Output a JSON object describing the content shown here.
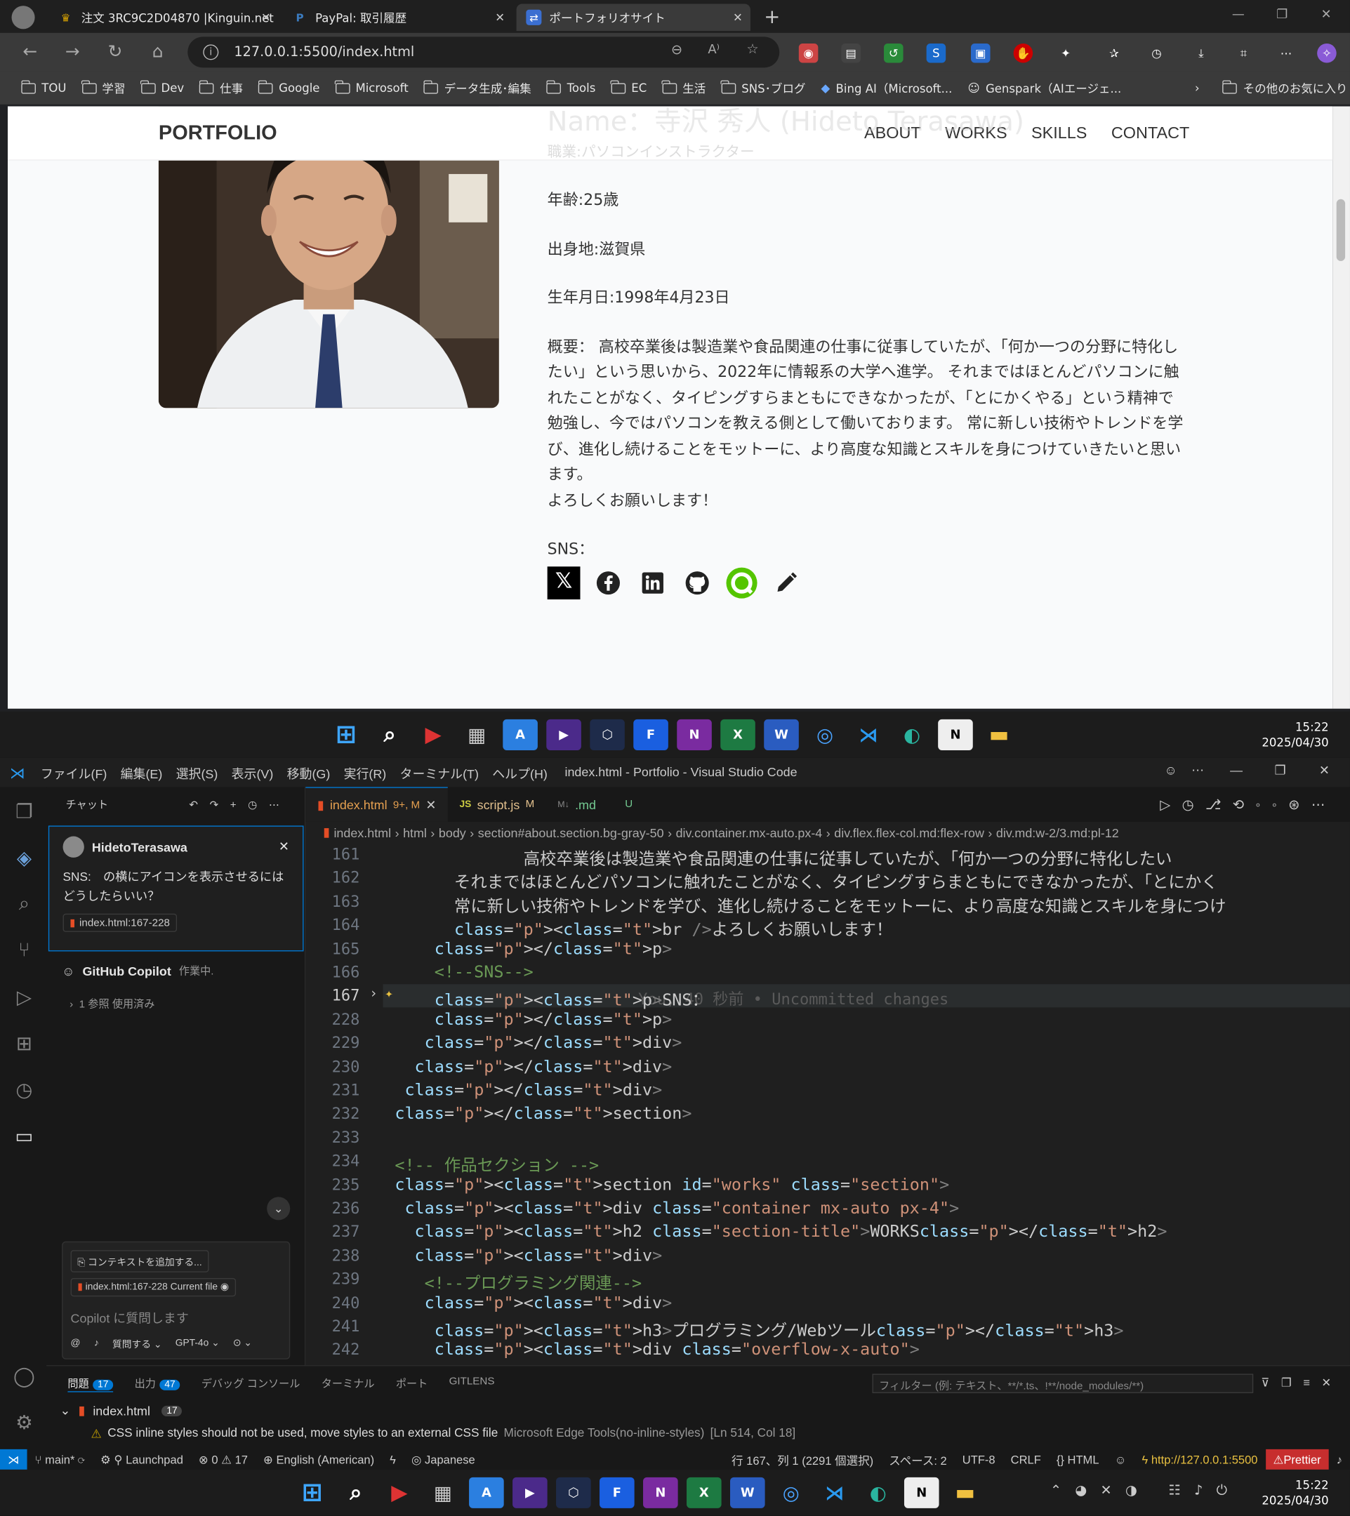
{
  "browser": {
    "tabs": [
      {
        "label": "注文 3RC9C2D04870 |Kinguin.net",
        "icon": "crown-icon"
      },
      {
        "label": "PayPal: 取引履歴",
        "icon": "paypal-icon"
      },
      {
        "label": "ポートフォリオサイト",
        "icon": "site-icon"
      }
    ],
    "url": "127.0.0.1:5500/index.html",
    "bookmarks": [
      "TOU",
      "学習",
      "Dev",
      "仕事",
      "Google",
      "Microsoft",
      "データ生成･編集",
      "Tools",
      "EC",
      "生活",
      "SNS･ブログ",
      "Bing AI（Microsoft...",
      "Genspark（AIエージェ...",
      "その他のお気に入り"
    ]
  },
  "site": {
    "logo": "PORTFOLIO",
    "nav": [
      "ABOUT",
      "WORKS",
      "SKILLS",
      "CONTACT"
    ],
    "ghost_name": "Name：寺沢 秀人 (Hideto Terasawa)",
    "ghost_job": "職業:パソコンインストラクター",
    "age": "年齢:25歳",
    "birthplace": "出身地:滋賀県",
    "birthday": "生年月日:1998年4月23日",
    "summary": "概要： 高校卒業後は製造業や食品関連の仕事に従事していたが、「何か一つの分野に特化したい」という思いから、2022年に情報系の大学へ進学。 それまではほとんどパソコンに触れたことがなく、タイピングすらまともにできなかったが、「とにかくやる」という精神で勉強し、今ではパソコンを教える側として働いております。 常に新しい技術やトレンドを学び、進化し続けることをモットーに、より高度な知識とスキルを身につけていきたいと思います。",
    "closing": "よろしくお願いします！",
    "sns_label": "SNS：",
    "sns_icons": [
      "x-icon",
      "facebook-icon",
      "linkedin-icon",
      "github-icon",
      "qiita-icon",
      "note-pen-icon"
    ]
  },
  "taskbar": {
    "time": "15:22",
    "date": "2025/04/30"
  },
  "vscode": {
    "menu": [
      "ファイル(F)",
      "編集(E)",
      "選択(S)",
      "表示(V)",
      "移動(G)",
      "実行(R)",
      "ターミナル(T)",
      "ヘルプ(H)"
    ],
    "title": "index.html - Portfolio - Visual Studio Code",
    "chat": {
      "header": "チャット",
      "user": "HidetoTerasawa",
      "question": "SNS:　の横にアイコンを表示させるにはどうしたらいい？",
      "file_ref": "index.html:167-228",
      "assistant": "GitHub Copilot",
      "assistant_status": "作業中.",
      "refs": "1 参照 使用済み",
      "add_context": "コンテキストを追加する...",
      "current_file": "index.html:167-228 Current file",
      "placeholder": "Copilot に質問します",
      "ask": "質問する",
      "model": "GPT-4o"
    },
    "tabs": [
      {
        "label": "index.html",
        "mark": "9+, M"
      },
      {
        "label": "script.js",
        "mark": "M"
      },
      {
        "label": ".md",
        "mark": "U"
      }
    ],
    "breadcrumbs": [
      "index.html",
      "html",
      "body",
      "section#about.section.bg-gray-50",
      "div.container.mx-auto.px-4",
      "div.flex.flex-col.md:flex-row",
      "div.md:w-2/3.md:pl-12"
    ],
    "lines": [
      {
        "n": "161",
        "text": "              高校卒業後は製造業や食品関連の仕事に従事していたが、「何か一つの分野に特化したい"
      },
      {
        "n": "162",
        "text": "       それまではほとんどパソコンに触れたことがなく、タイピングすらまともにできなかったが、「とにかく"
      },
      {
        "n": "163",
        "text": "       常に新しい技術やトレンドを学び、進化し続けることをモットーに、より高度な知識とスキルを身につけ"
      },
      {
        "n": "164",
        "text": "       <br />よろしくお願いします！"
      },
      {
        "n": "165",
        "text": "     </p>"
      },
      {
        "n": "166",
        "text": "     <!--SNS-->"
      },
      {
        "n": "167",
        "text": "     <p>SNS："
      },
      {
        "n": "228",
        "text": "     </p>"
      },
      {
        "n": "229",
        "text": "    </div>"
      },
      {
        "n": "230",
        "text": "   </div>"
      },
      {
        "n": "231",
        "text": "  </div>"
      },
      {
        "n": "232",
        "text": " </section>"
      },
      {
        "n": "233",
        "text": ""
      },
      {
        "n": "234",
        "text": " <!-- 作品セクション -->"
      },
      {
        "n": "235",
        "text": " <section id=\"works\" class=\"section\">"
      },
      {
        "n": "236",
        "text": "  <div class=\"container mx-auto px-4\">"
      },
      {
        "n": "237",
        "text": "   <h2 class=\"section-title\">WORKS</h2>"
      },
      {
        "n": "238",
        "text": "   <div>"
      },
      {
        "n": "239",
        "text": "    <!--プログラミング関連-->"
      },
      {
        "n": "240",
        "text": "    <div>"
      },
      {
        "n": "241",
        "text": "     <h3>プログラミング/Webツール</h3>"
      },
      {
        "n": "242",
        "text": "     <div class=\"overflow-x-auto\">"
      }
    ],
    "blame": "You, 40 秒前 • Uncommitted changes",
    "panel": {
      "tabs": [
        {
          "label": "問題",
          "count": "17"
        },
        {
          "label": "出力",
          "count": "47"
        },
        {
          "label": "デバッグ コンソール"
        },
        {
          "label": "ターミナル"
        },
        {
          "label": "ポート"
        },
        {
          "label": "GITLENS"
        }
      ],
      "filter_placeholder": "フィルター (例: テキスト、**/*.ts、!**/node_modules/**)",
      "file": "index.html",
      "file_count": "17",
      "problem": "CSS inline styles should not be used, move styles to an external CSS file",
      "problem_source": "Microsoft Edge Tools(no-inline-styles)",
      "problem_loc": "[Ln 514, Col 18]"
    },
    "status": {
      "branch": "main*",
      "launchpad": "Launchpad",
      "errors": "0",
      "warnings": "17",
      "lang_spell": "English (American)",
      "lang2": "Japanese",
      "cursor": "行 167、列 1 (2291 個選択)",
      "spaces": "スペース: 2",
      "encoding": "UTF-8",
      "eol": "CRLF",
      "mode": "HTML",
      "server": "http://127.0.0.1:5500",
      "prettier": "Prettier"
    }
  }
}
